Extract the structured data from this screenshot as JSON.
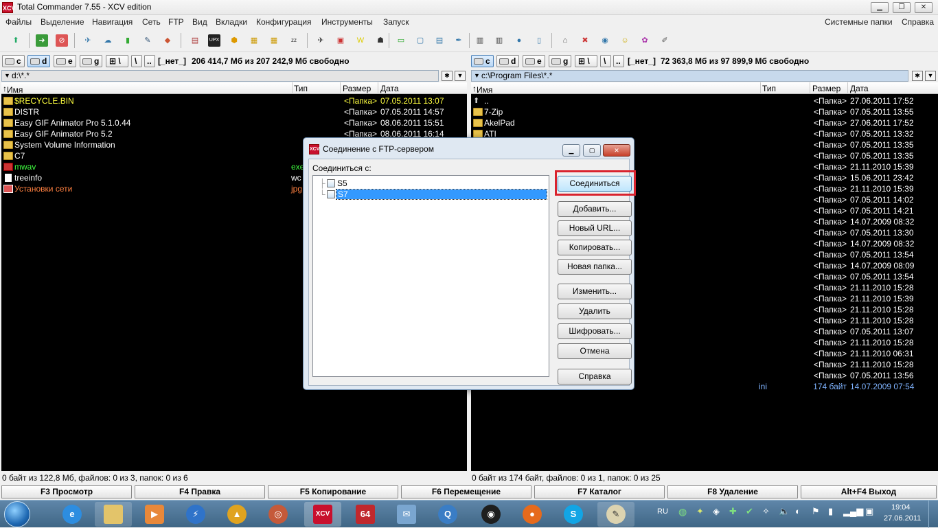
{
  "window": {
    "title": "Total Commander 7.55 - XCV edition",
    "logo": "XCV"
  },
  "menu": {
    "left": [
      "Файлы",
      "Выделение",
      "Навигация",
      "Сеть",
      "FTP",
      "Вид",
      "Вкладки",
      "Конфигурация",
      "Инструменты",
      "Запуск"
    ],
    "right": [
      "Системные папки",
      "Справка"
    ]
  },
  "left_drives": {
    "drives": [
      "c",
      "d",
      "e",
      "g"
    ],
    "active": "d",
    "label": "[_нет_]",
    "space": "206 414,7 Мб из 207 242,9 Мб свободно",
    "path": "d:\\*.*"
  },
  "right_drives": {
    "drives": [
      "c",
      "d",
      "e",
      "g"
    ],
    "active": "c",
    "label": "[_нет_]",
    "space": "72 363,8 Мб из 97 899,9 Мб свободно",
    "path": "c:\\Program Files\\*.*"
  },
  "columns": {
    "name": "Имя",
    "type": "Тип",
    "size": "Размер",
    "date": "Дата"
  },
  "colors": {
    "folder_text": "#ffffff",
    "selected_text": "#ffff40",
    "exe_text": "#40ff40",
    "img_text": "#ff8040",
    "date_text": "#ffffff",
    "dim_text": "#7fb3ff",
    "accent": "#d9232e"
  },
  "left_files": [
    {
      "name": "$RECYCLE.BIN",
      "ext": "",
      "size": "<Папка>",
      "date": "07.05.2011 13:07",
      "kind": "sel"
    },
    {
      "name": "DISTR",
      "ext": "",
      "size": "<Папка>",
      "date": "07.05.2011 14:57",
      "kind": "dir"
    },
    {
      "name": "Easy GIF Animator Pro 5.1.0.44",
      "ext": "",
      "size": "<Папка>",
      "date": "08.06.2011 15:51",
      "kind": "dir"
    },
    {
      "name": "Easy GIF Animator Pro 5.2",
      "ext": "",
      "size": "<Папка>",
      "date": "08.06.2011 16:14",
      "kind": "dir"
    },
    {
      "name": "System Volume Information",
      "ext": "",
      "size": "",
      "date": "",
      "kind": "dir"
    },
    {
      "name": "C7",
      "ext": "",
      "size": "",
      "date": "",
      "kind": "dir"
    },
    {
      "name": "mwav",
      "ext": "exe",
      "size": "",
      "date": "",
      "kind": "exe"
    },
    {
      "name": "treeinfo",
      "ext": "wc",
      "size": "",
      "date": "",
      "kind": "file"
    },
    {
      "name": "Установки сети",
      "ext": "jpg",
      "size": "",
      "date": "",
      "kind": "img"
    }
  ],
  "right_files": [
    {
      "name": "..",
      "ext": "",
      "size": "<Папка>",
      "date": "27.06.2011 17:52",
      "kind": "up"
    },
    {
      "name": "7-Zip",
      "ext": "",
      "size": "<Папка>",
      "date": "07.05.2011 13:55",
      "kind": "dir"
    },
    {
      "name": "AkelPad",
      "ext": "",
      "size": "<Папка>",
      "date": "27.06.2011 17:52",
      "kind": "dir"
    },
    {
      "name": "ATI",
      "ext": "",
      "size": "<Папка>",
      "date": "07.05.2011 13:32",
      "kind": "dir"
    },
    {
      "name": "",
      "ext": "",
      "size": "<Папка>",
      "date": "07.05.2011 13:35",
      "kind": "hidden"
    },
    {
      "name": "",
      "ext": "",
      "size": "<Папка>",
      "date": "07.05.2011 13:35",
      "kind": "hidden"
    },
    {
      "name": "",
      "ext": "",
      "size": "<Папка>",
      "date": "21.11.2010 15:39",
      "kind": "hidden"
    },
    {
      "name": "",
      "ext": "",
      "size": "<Папка>",
      "date": "15.06.2011 23:42",
      "kind": "hidden"
    },
    {
      "name": "",
      "ext": "",
      "size": "<Папка>",
      "date": "21.11.2010 15:39",
      "kind": "hidden"
    },
    {
      "name": "",
      "ext": "",
      "size": "<Папка>",
      "date": "07.05.2011 14:02",
      "kind": "hidden"
    },
    {
      "name": "",
      "ext": "",
      "size": "<Папка>",
      "date": "07.05.2011 14:21",
      "kind": "hidden"
    },
    {
      "name": "",
      "ext": "",
      "size": "<Папка>",
      "date": "14.07.2009 08:32",
      "kind": "hidden"
    },
    {
      "name": "",
      "ext": "",
      "size": "<Папка>",
      "date": "07.05.2011 13:30",
      "kind": "hidden"
    },
    {
      "name": "",
      "ext": "",
      "size": "<Папка>",
      "date": "14.07.2009 08:32",
      "kind": "hidden"
    },
    {
      "name": "",
      "ext": "",
      "size": "<Папка>",
      "date": "07.05.2011 13:54",
      "kind": "hidden"
    },
    {
      "name": "",
      "ext": "",
      "size": "<Папка>",
      "date": "14.07.2009 08:09",
      "kind": "hidden"
    },
    {
      "name": "",
      "ext": "",
      "size": "<Папка>",
      "date": "07.05.2011 13:54",
      "kind": "hidden"
    },
    {
      "name": "",
      "ext": "",
      "size": "<Папка>",
      "date": "21.11.2010 15:28",
      "kind": "hidden"
    },
    {
      "name": "",
      "ext": "",
      "size": "<Папка>",
      "date": "21.11.2010 15:39",
      "kind": "hidden"
    },
    {
      "name": "",
      "ext": "",
      "size": "<Папка>",
      "date": "21.11.2010 15:28",
      "kind": "hidden"
    },
    {
      "name": "",
      "ext": "",
      "size": "<Папка>",
      "date": "21.11.2010 15:28",
      "kind": "hidden"
    },
    {
      "name": "",
      "ext": "",
      "size": "<Папка>",
      "date": "07.05.2011 13:07",
      "kind": "hidden"
    },
    {
      "name": "",
      "ext": "",
      "size": "<Папка>",
      "date": "21.11.2010 15:28",
      "kind": "hidden"
    },
    {
      "name": "",
      "ext": "",
      "size": "<Папка>",
      "date": "21.11.2010 06:31",
      "kind": "hidden"
    },
    {
      "name": "",
      "ext": "",
      "size": "<Папка>",
      "date": "21.11.2010 15:28",
      "kind": "hidden"
    },
    {
      "name": "",
      "ext": "",
      "size": "<Папка>",
      "date": "07.05.2011 13:56",
      "kind": "hidden"
    },
    {
      "name": "",
      "ext": "ini",
      "size": "174 байт",
      "date": "14.07.2009 07:54",
      "kind": "ini"
    }
  ],
  "status": {
    "left": "0 байт из 122,8 Мб, файлов: 0 из 3, папок: 0 из 6",
    "right": "0 байт из 174 байт, файлов: 0 из 1, папок: 0 из 25"
  },
  "fkeys": [
    "F3 Просмотр",
    "F4 Правка",
    "F5 Копирование",
    "F6 Перемещение",
    "F7 Каталог",
    "F8 Удаление",
    "Alt+F4 Выход"
  ],
  "dialog": {
    "title": "Соединение с FTP-сервером",
    "label": "Соединиться с:",
    "servers": [
      "S5",
      "S7"
    ],
    "selected": "S7",
    "buttons": {
      "connect": "Соединиться",
      "add": "Добавить...",
      "new_url": "Новый URL...",
      "copy": "Копировать...",
      "new_folder": "Новая папка...",
      "edit": "Изменить...",
      "delete": "Удалить",
      "encrypt": "Шифровать...",
      "cancel": "Отмена",
      "help": "Справка"
    }
  },
  "taskbar": {
    "lang": "RU",
    "time": "19:04",
    "date": "27.06.2011",
    "app_64_label": "64",
    "app_xcv_label": "XCV"
  }
}
